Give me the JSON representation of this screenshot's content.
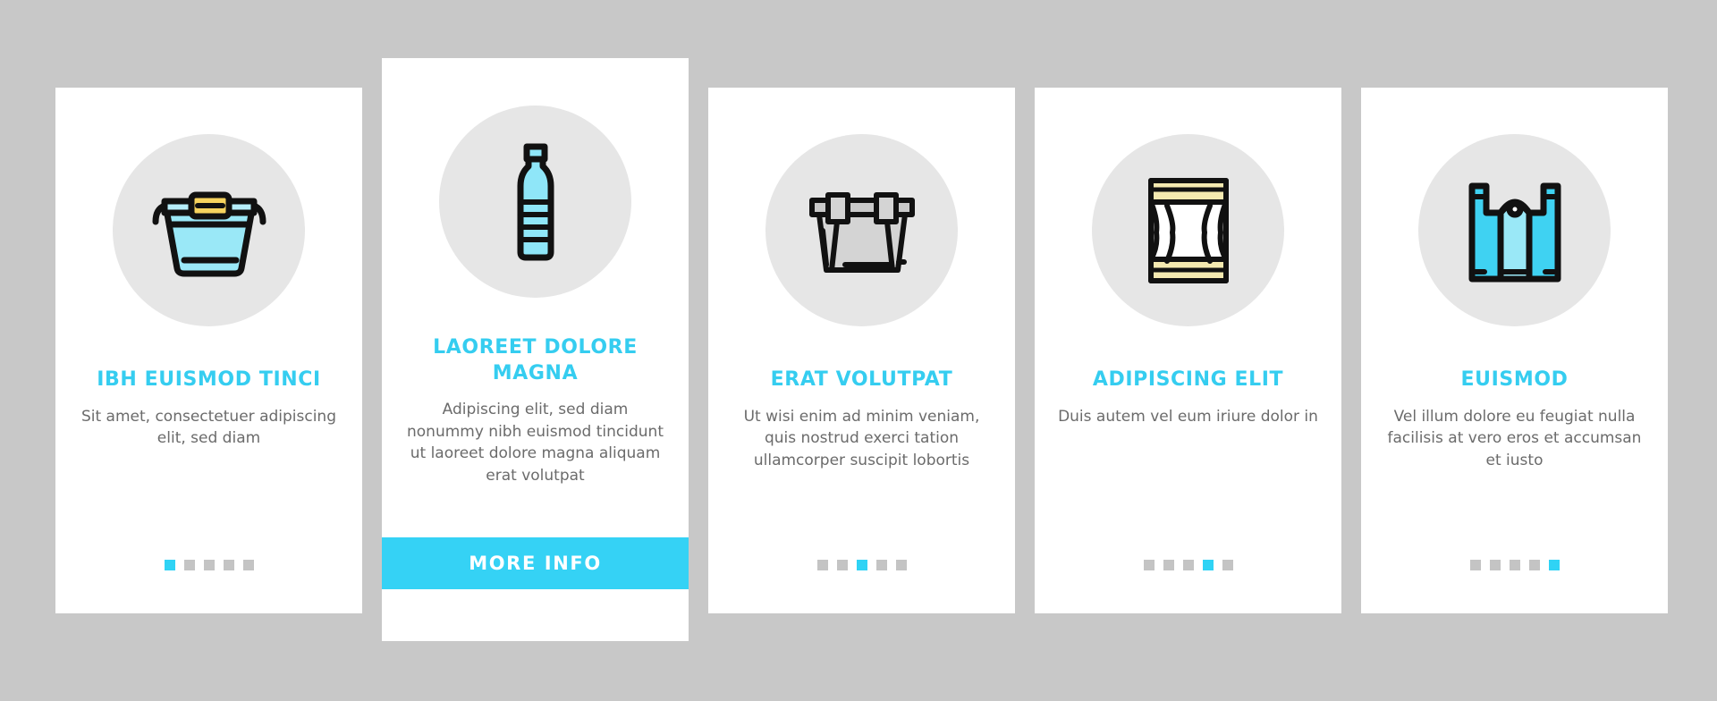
{
  "meta": {
    "background_color": "#c8c8c8",
    "card_background": "#ffffff",
    "accent_color": "#35cdf0",
    "button_color": "#35d2f5",
    "body_text_color": "#6b6b6b",
    "icon_circle_color": "#e6e6e6",
    "dot_inactive_color": "#c4c4c4",
    "dot_active_color": "#2fd3f5"
  },
  "cards": [
    {
      "icon_name": "food-container-icon",
      "title": "IBH EUISMOD TINCI",
      "body": "Sit amet, consectetuer adipiscing elit, sed diam",
      "dots": {
        "count": 5,
        "active_index": 0
      },
      "featured": false
    },
    {
      "icon_name": "plastic-bottle-icon",
      "title": "LAOREET DOLORE MAGNA",
      "body": "Adipiscing elit, sed diam nonummy nibh euismod tincidunt ut laoreet dolore magna aliquam erat volutpat",
      "button_label": "MORE INFO",
      "featured": true
    },
    {
      "icon_name": "storage-crate-icon",
      "title": "ERAT VOLUTPAT",
      "body": "Ut wisi enim ad minim veniam, quis nostrud exerci tation ullamcorper suscipit lobortis",
      "dots": {
        "count": 5,
        "active_index": 2
      },
      "featured": false
    },
    {
      "icon_name": "snack-bag-icon",
      "title": "ADIPISCING ELIT",
      "body": "Duis autem vel eum iriure dolor in",
      "dots": {
        "count": 5,
        "active_index": 3
      },
      "featured": false
    },
    {
      "icon_name": "plastic-shopping-bag-icon",
      "title": "EUISMOD",
      "body": "Vel illum dolore eu feugiat nulla facilisis at vero eros et accumsan et iusto",
      "dots": {
        "count": 5,
        "active_index": 4
      },
      "featured": false
    }
  ]
}
